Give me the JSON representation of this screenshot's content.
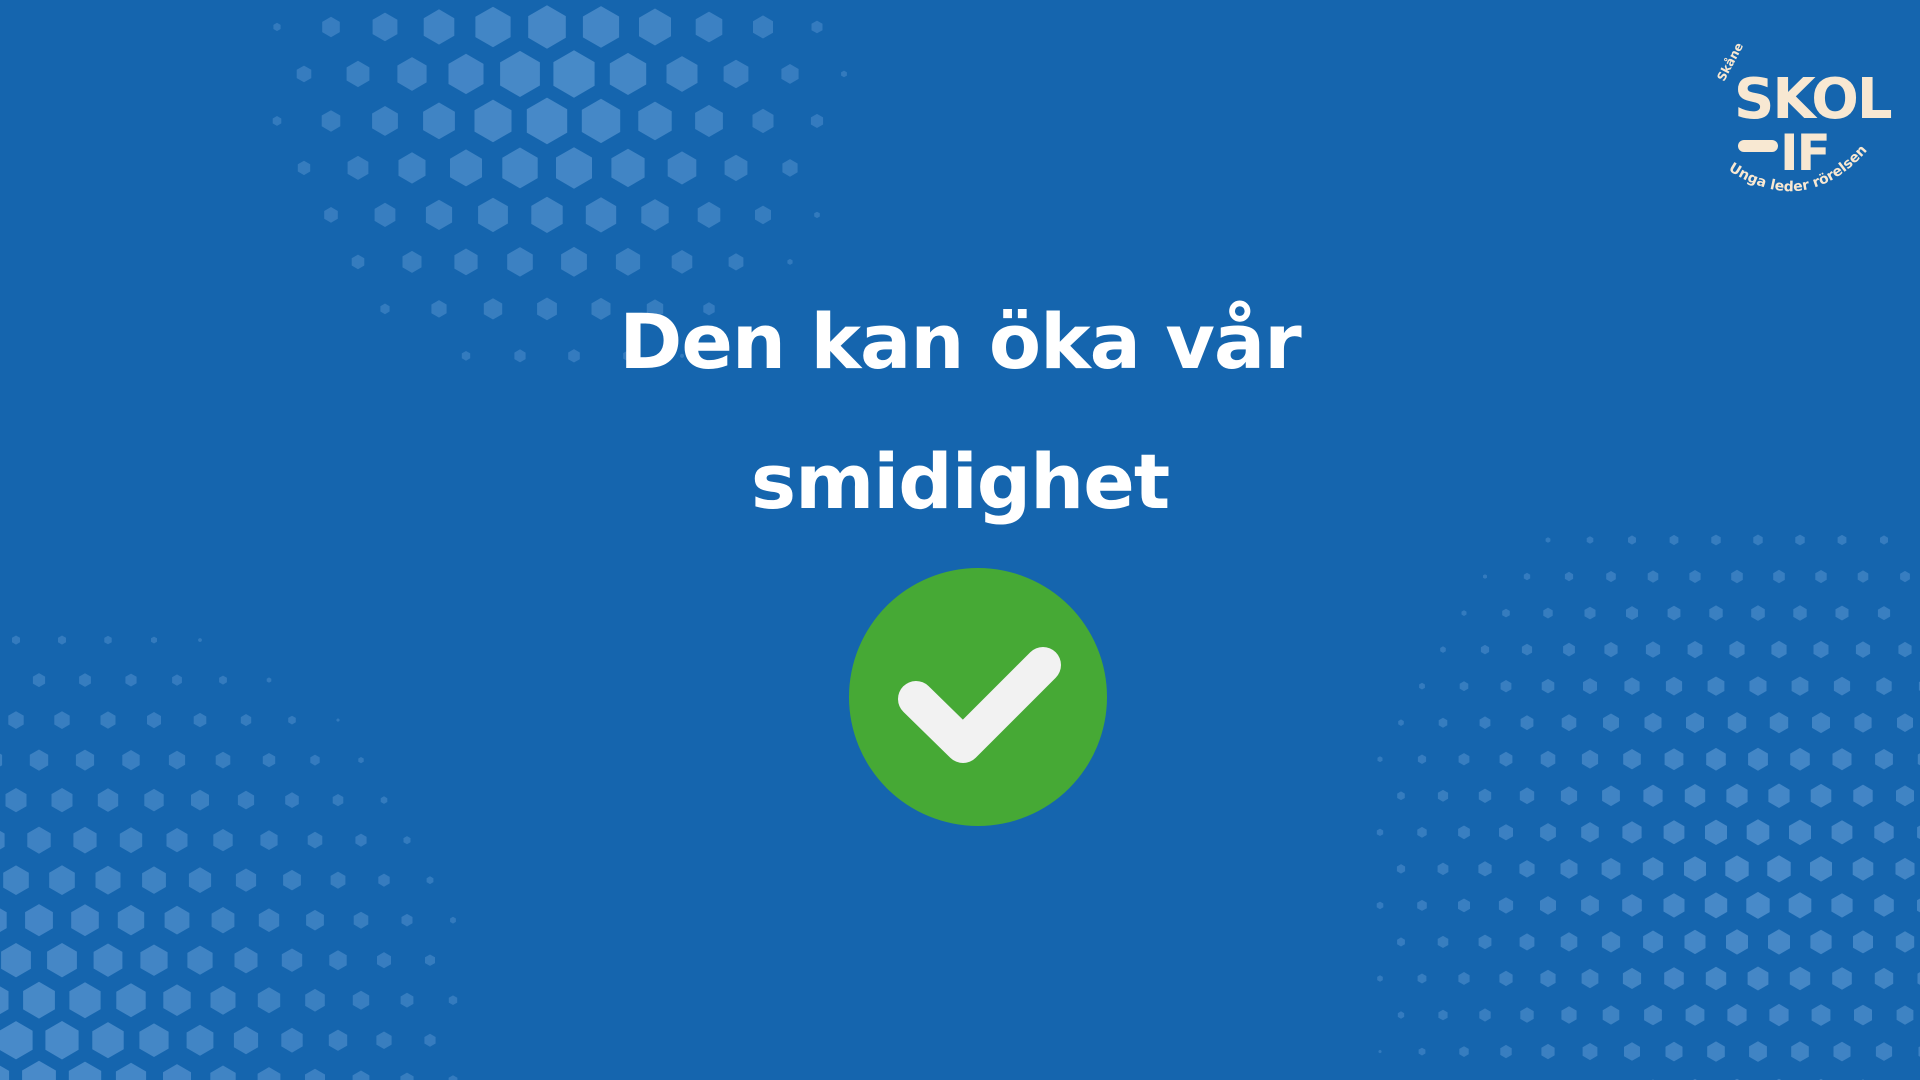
{
  "slide": {
    "headline_line1": "Den kan öka vår",
    "headline_line2": "smidighet"
  },
  "logo": {
    "region_text": "Skåne",
    "wordmark": "SKOL IF",
    "tagline": "Unga leder rörelsen"
  },
  "icons": {
    "answer_icon": "check-circle-icon"
  },
  "colors": {
    "background": "#1565AE",
    "pattern": "#4A8BC9",
    "check_green": "#46A935",
    "check_mark": "#F2F2F2",
    "logo_cream": "#F8E8D2",
    "headline": "#FFFFFF"
  }
}
